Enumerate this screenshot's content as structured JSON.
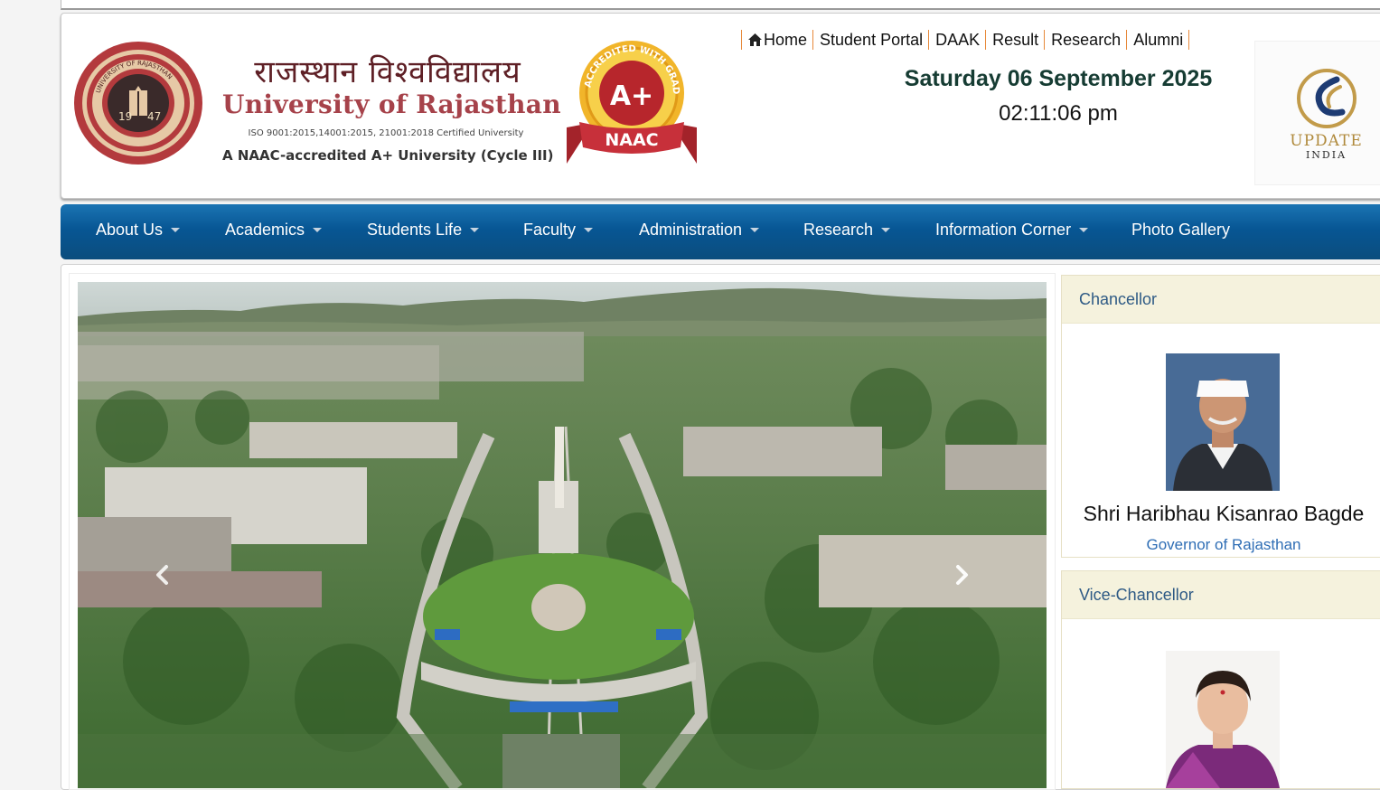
{
  "header": {
    "title_hindi": "राजस्थान विश्वविद्यालय",
    "title_english": "University of Rajasthan",
    "iso_line": "ISO 9001:2015,14001:2015, 21001:2018 Certified University",
    "naac_line": "A NAAC-accredited A+ University (Cycle III)",
    "seal_text": "UNIVERSITY OF RAJASTHAN",
    "seal_year_left": "19",
    "seal_year_right": "47",
    "badge_grade": "A+",
    "badge_ribbon": "NAAC",
    "badge_arc": "ACCREDITED WITH GRADE",
    "top_links": [
      "Home",
      "Student Portal",
      "DAAK",
      "Result",
      "Research",
      "Alumni"
    ],
    "date": "Saturday 06 September 2025",
    "time": "02:11:06 pm",
    "sponsor_name": "UPDATE",
    "sponsor_sub": "INDIA"
  },
  "nav": {
    "items": [
      "About Us",
      "Academics",
      "Students Life",
      "Faculty",
      "Administration",
      "Research",
      "Information Corner",
      "Photo Gallery"
    ]
  },
  "slider": {
    "prev_icon": "chevron-left-icon",
    "next_icon": "chevron-right-icon"
  },
  "sidebar": {
    "chancellor": {
      "heading": "Chancellor",
      "name": "Shri Haribhau Kisanrao Bagde",
      "title": "Governor of Rajasthan"
    },
    "vice_chancellor": {
      "heading": "Vice-Chancellor"
    }
  },
  "colors": {
    "nav_blue": "#075694",
    "maroon": "#5e1f25",
    "panel_head_bg": "#f5f2dd",
    "link_blue": "#2f6eb5",
    "separator_orange": "#e7893a"
  }
}
